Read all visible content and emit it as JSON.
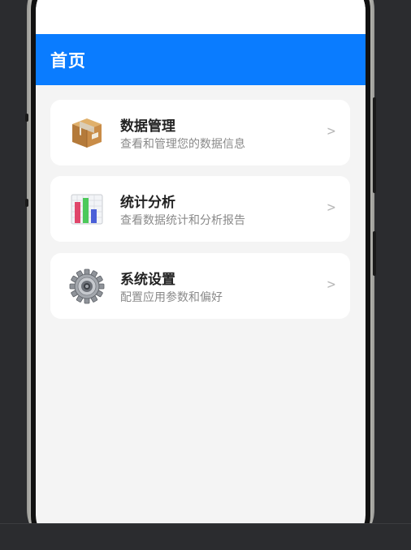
{
  "header": {
    "title": "首页"
  },
  "menu": {
    "items": [
      {
        "title": "数据管理",
        "subtitle": "查看和管理您的数据信息",
        "icon": "package-box-icon",
        "arrow": ">"
      },
      {
        "title": "统计分析",
        "subtitle": "查看数据统计和分析报告",
        "icon": "bar-chart-icon",
        "arrow": ">"
      },
      {
        "title": "系统设置",
        "subtitle": "配置应用参数和偏好",
        "icon": "gear-icon",
        "arrow": ">"
      }
    ]
  },
  "colors": {
    "header_bg": "#0a7cff",
    "page_bg": "#f4f4f4",
    "card_bg": "#ffffff",
    "title_text": "#222222",
    "subtitle_text": "#8a8a8a",
    "arrow": "#b7b7b7",
    "backdrop": "#2b2c2f"
  }
}
